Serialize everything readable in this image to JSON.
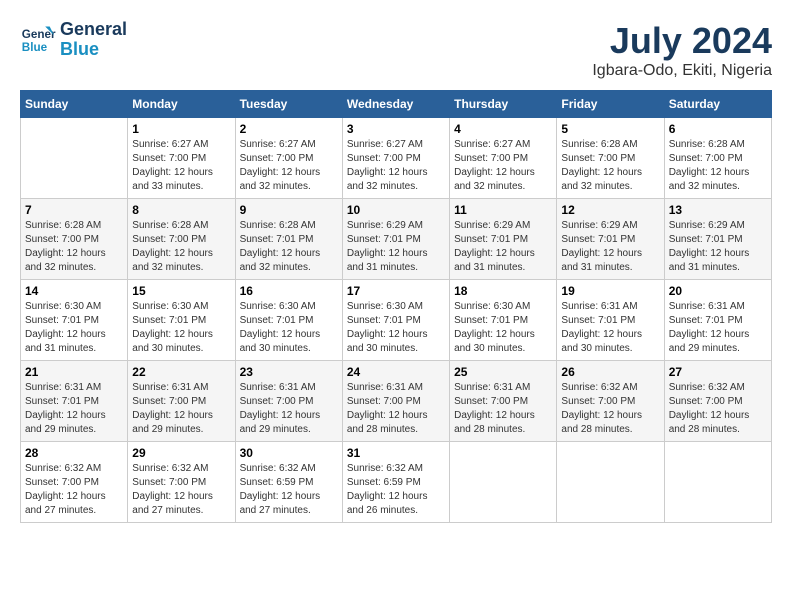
{
  "header": {
    "logo_line1": "General",
    "logo_line2": "Blue",
    "month_year": "July 2024",
    "location": "Igbara-Odo, Ekiti, Nigeria"
  },
  "weekdays": [
    "Sunday",
    "Monday",
    "Tuesday",
    "Wednesday",
    "Thursday",
    "Friday",
    "Saturday"
  ],
  "weeks": [
    [
      {
        "day": "",
        "info": ""
      },
      {
        "day": "1",
        "info": "Sunrise: 6:27 AM\nSunset: 7:00 PM\nDaylight: 12 hours\nand 33 minutes."
      },
      {
        "day": "2",
        "info": "Sunrise: 6:27 AM\nSunset: 7:00 PM\nDaylight: 12 hours\nand 32 minutes."
      },
      {
        "day": "3",
        "info": "Sunrise: 6:27 AM\nSunset: 7:00 PM\nDaylight: 12 hours\nand 32 minutes."
      },
      {
        "day": "4",
        "info": "Sunrise: 6:27 AM\nSunset: 7:00 PM\nDaylight: 12 hours\nand 32 minutes."
      },
      {
        "day": "5",
        "info": "Sunrise: 6:28 AM\nSunset: 7:00 PM\nDaylight: 12 hours\nand 32 minutes."
      },
      {
        "day": "6",
        "info": "Sunrise: 6:28 AM\nSunset: 7:00 PM\nDaylight: 12 hours\nand 32 minutes."
      }
    ],
    [
      {
        "day": "7",
        "info": "Sunrise: 6:28 AM\nSunset: 7:00 PM\nDaylight: 12 hours\nand 32 minutes."
      },
      {
        "day": "8",
        "info": "Sunrise: 6:28 AM\nSunset: 7:00 PM\nDaylight: 12 hours\nand 32 minutes."
      },
      {
        "day": "9",
        "info": "Sunrise: 6:28 AM\nSunset: 7:01 PM\nDaylight: 12 hours\nand 32 minutes."
      },
      {
        "day": "10",
        "info": "Sunrise: 6:29 AM\nSunset: 7:01 PM\nDaylight: 12 hours\nand 31 minutes."
      },
      {
        "day": "11",
        "info": "Sunrise: 6:29 AM\nSunset: 7:01 PM\nDaylight: 12 hours\nand 31 minutes."
      },
      {
        "day": "12",
        "info": "Sunrise: 6:29 AM\nSunset: 7:01 PM\nDaylight: 12 hours\nand 31 minutes."
      },
      {
        "day": "13",
        "info": "Sunrise: 6:29 AM\nSunset: 7:01 PM\nDaylight: 12 hours\nand 31 minutes."
      }
    ],
    [
      {
        "day": "14",
        "info": "Sunrise: 6:30 AM\nSunset: 7:01 PM\nDaylight: 12 hours\nand 31 minutes."
      },
      {
        "day": "15",
        "info": "Sunrise: 6:30 AM\nSunset: 7:01 PM\nDaylight: 12 hours\nand 30 minutes."
      },
      {
        "day": "16",
        "info": "Sunrise: 6:30 AM\nSunset: 7:01 PM\nDaylight: 12 hours\nand 30 minutes."
      },
      {
        "day": "17",
        "info": "Sunrise: 6:30 AM\nSunset: 7:01 PM\nDaylight: 12 hours\nand 30 minutes."
      },
      {
        "day": "18",
        "info": "Sunrise: 6:30 AM\nSunset: 7:01 PM\nDaylight: 12 hours\nand 30 minutes."
      },
      {
        "day": "19",
        "info": "Sunrise: 6:31 AM\nSunset: 7:01 PM\nDaylight: 12 hours\nand 30 minutes."
      },
      {
        "day": "20",
        "info": "Sunrise: 6:31 AM\nSunset: 7:01 PM\nDaylight: 12 hours\nand 29 minutes."
      }
    ],
    [
      {
        "day": "21",
        "info": "Sunrise: 6:31 AM\nSunset: 7:01 PM\nDaylight: 12 hours\nand 29 minutes."
      },
      {
        "day": "22",
        "info": "Sunrise: 6:31 AM\nSunset: 7:00 PM\nDaylight: 12 hours\nand 29 minutes."
      },
      {
        "day": "23",
        "info": "Sunrise: 6:31 AM\nSunset: 7:00 PM\nDaylight: 12 hours\nand 29 minutes."
      },
      {
        "day": "24",
        "info": "Sunrise: 6:31 AM\nSunset: 7:00 PM\nDaylight: 12 hours\nand 28 minutes."
      },
      {
        "day": "25",
        "info": "Sunrise: 6:31 AM\nSunset: 7:00 PM\nDaylight: 12 hours\nand 28 minutes."
      },
      {
        "day": "26",
        "info": "Sunrise: 6:32 AM\nSunset: 7:00 PM\nDaylight: 12 hours\nand 28 minutes."
      },
      {
        "day": "27",
        "info": "Sunrise: 6:32 AM\nSunset: 7:00 PM\nDaylight: 12 hours\nand 28 minutes."
      }
    ],
    [
      {
        "day": "28",
        "info": "Sunrise: 6:32 AM\nSunset: 7:00 PM\nDaylight: 12 hours\nand 27 minutes."
      },
      {
        "day": "29",
        "info": "Sunrise: 6:32 AM\nSunset: 7:00 PM\nDaylight: 12 hours\nand 27 minutes."
      },
      {
        "day": "30",
        "info": "Sunrise: 6:32 AM\nSunset: 6:59 PM\nDaylight: 12 hours\nand 27 minutes."
      },
      {
        "day": "31",
        "info": "Sunrise: 6:32 AM\nSunset: 6:59 PM\nDaylight: 12 hours\nand 26 minutes."
      },
      {
        "day": "",
        "info": ""
      },
      {
        "day": "",
        "info": ""
      },
      {
        "day": "",
        "info": ""
      }
    ]
  ]
}
